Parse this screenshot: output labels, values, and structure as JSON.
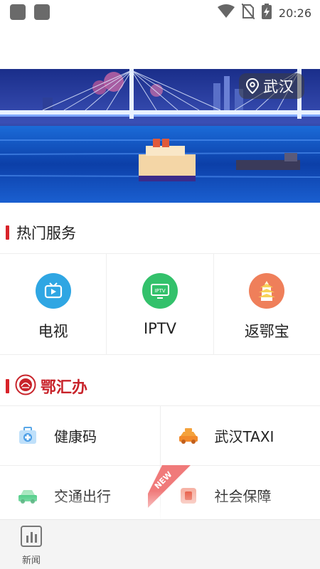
{
  "status_bar": {
    "time": "20:26",
    "icons": [
      "wifi-icon",
      "no-sim-icon",
      "battery-charging-icon"
    ]
  },
  "banner": {
    "location": "武汉",
    "location_icon": "map-pin-icon"
  },
  "hot_services": {
    "title": "热门服务",
    "items": [
      {
        "label": "电视",
        "icon": "tv-icon",
        "color": "#2fa6e3"
      },
      {
        "label": "IPTV",
        "icon": "iptv-icon",
        "color": "#33c16b"
      },
      {
        "label": "返鄂宝",
        "icon": "yellow-crane-tower-icon",
        "color": "#ef7f5a"
      }
    ]
  },
  "ehb": {
    "title": "鄂汇办",
    "items": [
      {
        "label": "健康码",
        "icon": "first-aid-kit-icon"
      },
      {
        "label": "武汉TAXI",
        "icon": "taxi-icon"
      },
      {
        "label": "交通出行",
        "icon": "car-icon"
      },
      {
        "label": "社会保障",
        "icon": "social-security-icon",
        "badge": "NEW"
      }
    ]
  },
  "tab_bar": {
    "items": [
      {
        "label": "新闻",
        "icon": "news-chart-icon"
      }
    ]
  },
  "colors": {
    "accent_red": "#d8232a",
    "tv_blue": "#2fa6e3",
    "iptv_green": "#33c16b",
    "fanebao_orange": "#ef7f5a"
  }
}
